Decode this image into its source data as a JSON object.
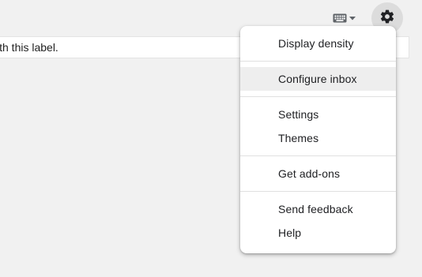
{
  "toolbar": {
    "keyboard_icon": "keyboard-icon",
    "dropdown_icon": "caret-down-icon",
    "settings_icon": "gear-icon"
  },
  "notice": {
    "text": "ith this label."
  },
  "settings_menu": {
    "highlighted_item": "Configure inbox",
    "groups": [
      [
        "Display density"
      ],
      [
        "Configure inbox"
      ],
      [
        "Settings",
        "Themes"
      ],
      [
        "Get add-ons"
      ],
      [
        "Send feedback",
        "Help"
      ]
    ]
  },
  "colors": {
    "background": "#f1f1f1",
    "menu_background": "#ffffff",
    "highlight": "#eeeeee",
    "gear_button_bg": "#dcdcdc",
    "text": "#202124"
  }
}
